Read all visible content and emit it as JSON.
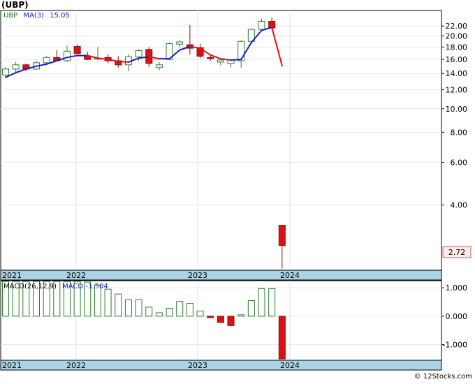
{
  "title": "(UBP)",
  "watermark": "© 12Stocks.com",
  "legend": {
    "ticker": "UBP",
    "ma_label": "MA(3)",
    "ma_value": "15.05"
  },
  "macd_legend": {
    "label": "MACD(26,12,9)",
    "value_label": "MACD:-1.504"
  },
  "last_price_label": "2.72",
  "colors": {
    "up": "#2e7d2e",
    "down": "#e01010",
    "ma_up": "#1a1ad0",
    "ma_down": "#e01010",
    "axis_band": "#aad4e6",
    "grid": "#e6e6e6"
  },
  "chart_data": [
    {
      "type": "candlestick",
      "y_scale": "log",
      "ylim": [
        2.15,
        25.5
      ],
      "y_ticks": [
        "22.00",
        "20.00",
        "18.00",
        "16.00",
        "14.00",
        "12.00",
        "10.00",
        "8.00",
        "6.00",
        "4.00"
      ],
      "x_tick_labels": [
        "2021",
        "2022",
        "2023",
        "2024"
      ],
      "ma_label": "MA(3)",
      "ohlc": [
        [
          13.8,
          14.9,
          13.5,
          14.6
        ],
        [
          14.6,
          15.6,
          14.2,
          15.2
        ],
        [
          15.2,
          15.4,
          14.3,
          14.6
        ],
        [
          14.6,
          15.8,
          14.5,
          15.5
        ],
        [
          15.5,
          16.5,
          15.2,
          16.3
        ],
        [
          16.3,
          17.5,
          15.8,
          15.8
        ],
        [
          15.8,
          18.2,
          15.6,
          17.3
        ],
        [
          18.1,
          18.5,
          16.8,
          16.9
        ],
        [
          16.5,
          17.2,
          15.9,
          16.0
        ],
        [
          16.1,
          18.0,
          15.9,
          16.2
        ],
        [
          16.3,
          16.8,
          15.4,
          15.8
        ],
        [
          15.8,
          16.5,
          14.8,
          15.2
        ],
        [
          15.2,
          16.8,
          14.3,
          16.4
        ],
        [
          16.4,
          17.6,
          15.8,
          17.4
        ],
        [
          17.6,
          18.0,
          14.9,
          15.4
        ],
        [
          14.8,
          15.6,
          14.4,
          15.2
        ],
        [
          16.0,
          18.8,
          15.9,
          18.6
        ],
        [
          18.5,
          19.2,
          18.0,
          18.9
        ],
        [
          18.4,
          22.2,
          16.8,
          17.8
        ],
        [
          17.9,
          18.6,
          16.2,
          16.5
        ],
        [
          16.3,
          16.8,
          15.8,
          16.2
        ],
        [
          15.6,
          16.2,
          15.1,
          15.9
        ],
        [
          15.4,
          16.0,
          14.8,
          15.9
        ],
        [
          15.8,
          19.2,
          14.8,
          19.0
        ],
        [
          19.0,
          21.5,
          18.6,
          21.3
        ],
        [
          21.3,
          23.6,
          20.9,
          23.0
        ],
        [
          23.0,
          23.8,
          21.2,
          21.6
        ],
        [
          3.3,
          3.3,
          2.18,
          2.72
        ]
      ],
      "ma_values": [
        13.5,
        14.1,
        14.6,
        15.0,
        15.3,
        15.8,
        16.3,
        16.6,
        16.6,
        16.2,
        16.0,
        15.7,
        15.6,
        16.2,
        16.4,
        16.1,
        16.1,
        17.5,
        18.1,
        17.8,
        16.7,
        16.1,
        15.9,
        16.0,
        18.8,
        21.1,
        21.7,
        15.05
      ]
    },
    {
      "type": "bar",
      "name": "MACD(26,12,9)",
      "ylim": [
        -1.55,
        1.25
      ],
      "y_ticks": [
        "1.000",
        "0.000",
        "-1.000"
      ],
      "x_tick_labels": [
        "2021",
        "2022",
        "2023",
        "2024"
      ],
      "values": [
        1.25,
        1.45,
        1.45,
        1.55,
        1.6,
        1.55,
        1.62,
        1.55,
        1.2,
        1.1,
        0.95,
        0.78,
        0.58,
        0.58,
        0.32,
        0.12,
        0.28,
        0.52,
        0.45,
        0.18,
        -0.05,
        -0.22,
        -0.33,
        0.05,
        0.55,
        0.97,
        0.97,
        -1.504
      ]
    }
  ]
}
